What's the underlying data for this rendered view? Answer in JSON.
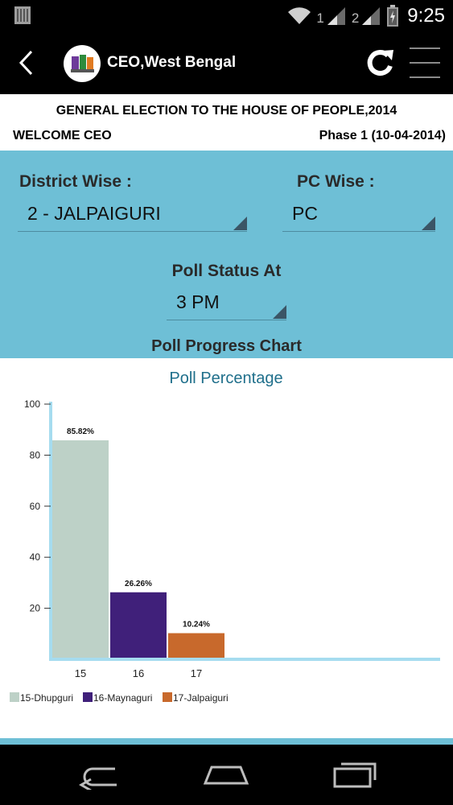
{
  "status_bar": {
    "time": "9:25",
    "sim1": "1",
    "sim2": "2",
    "icons": [
      "notification-icon",
      "wifi-icon",
      "signal-icon",
      "battery-icon"
    ]
  },
  "app_bar": {
    "title": "CEO,West Bengal",
    "icons": [
      "back-icon",
      "app-logo",
      "refresh-icon",
      "menu-icon"
    ]
  },
  "header": {
    "title": "GENERAL ELECTION TO THE HOUSE OF PEOPLE,2014",
    "welcome": "WELCOME CEO",
    "phase": "Phase 1 (10-04-2014)"
  },
  "filters": {
    "district_label": "District Wise :",
    "district_value": "2 - JALPAIGURI",
    "pc_label": "PC Wise :",
    "pc_value": "PC",
    "poll_status_label": "Poll Status At",
    "poll_status_value": "3 PM",
    "chart_heading": "Poll Progress Chart"
  },
  "chart_data": {
    "type": "bar",
    "title": "Poll Percentage",
    "categories": [
      "15",
      "16",
      "17"
    ],
    "values": [
      85.82,
      26.26,
      10.24
    ],
    "data_labels": [
      "85.82%",
      "26.26%",
      "10.24%"
    ],
    "legend": [
      "15-Dhupguri",
      "16-Maynaguri",
      "17-Jalpaiguri"
    ],
    "colors": [
      "#bdd1c7",
      "#40207a",
      "#c8692c"
    ],
    "axis_color": "#a6dcef",
    "yticks": [
      "20",
      "40",
      "60",
      "80",
      "100"
    ],
    "ylim": [
      0,
      100
    ],
    "legend_position": "bottom-left",
    "grid": false
  },
  "theme": {
    "panel_color": "#6ebfd6",
    "bar_background": "#000000"
  }
}
